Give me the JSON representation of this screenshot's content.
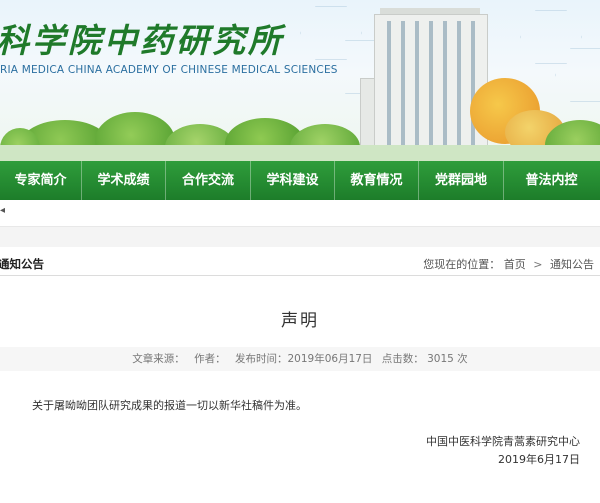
{
  "banner": {
    "title": "科学院中药研究所",
    "subtitle": "RIA MEDICA CHINA ACADEMY OF CHINESE MEDICAL SCIENCES"
  },
  "nav": {
    "items": [
      {
        "label": "专家简介"
      },
      {
        "label": "学术成绩"
      },
      {
        "label": "合作交流"
      },
      {
        "label": "学科建设"
      },
      {
        "label": "教育情况"
      },
      {
        "label": "党群园地"
      },
      {
        "label": "普法内控"
      }
    ]
  },
  "section": {
    "name": "通知公告",
    "breadcrumb_prefix": "您现在的位置：",
    "breadcrumb": [
      "首页",
      "通知公告"
    ]
  },
  "article": {
    "title": "声明",
    "meta": {
      "source": "文章来源：",
      "author": "作者：",
      "published": "发布时间：2019年06月17日",
      "views": "点击数： 3015 次"
    },
    "body": "关于屠呦呦团队研究成果的报道一切以新华社稿件为准。",
    "signature_org": "中国中医科学院青蒿素研究中心",
    "signature_date": "2019年6月17日"
  },
  "colors": {
    "nav_green": "#1d7d2a",
    "title_green": "#1f7a2a",
    "subtitle_blue": "#2b6fa0"
  }
}
